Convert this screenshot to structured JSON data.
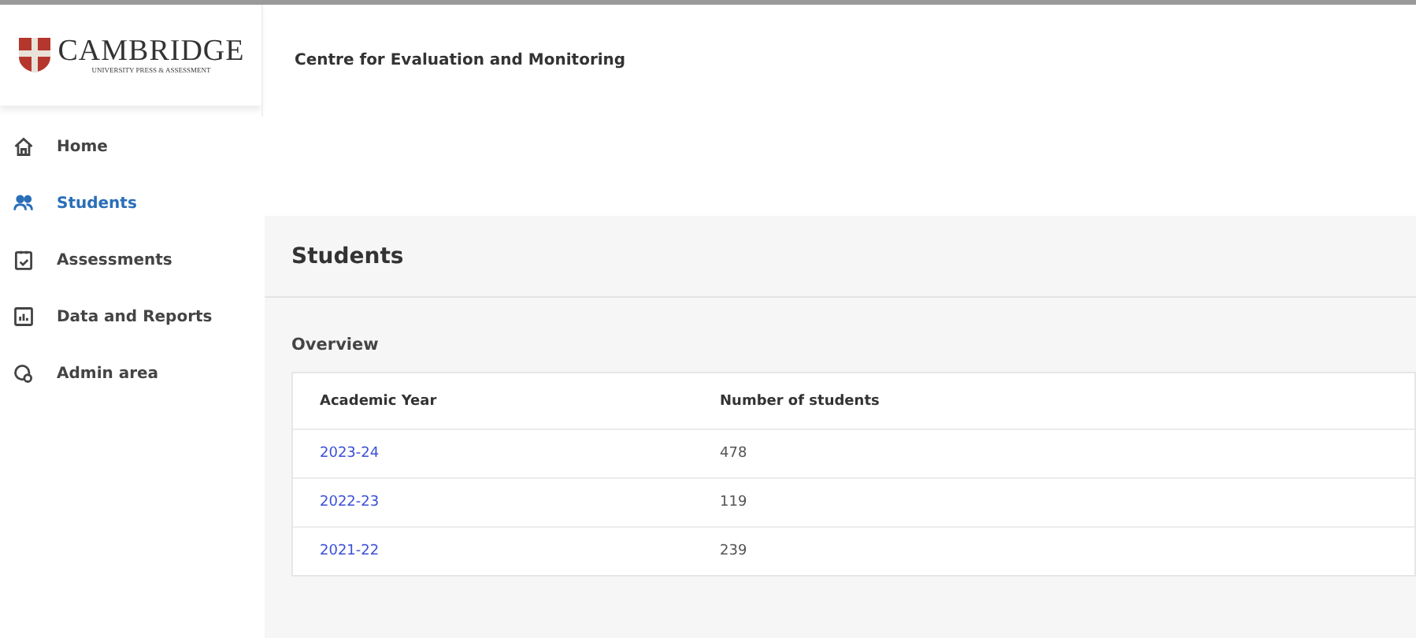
{
  "logo": {
    "name": "CAMBRIDGE",
    "subtitle": "UNIVERSITY PRESS & ASSESSMENT"
  },
  "header": {
    "title": "Centre for Evaluation and Monitoring"
  },
  "sidebar": {
    "items": [
      {
        "label": "Home",
        "kind": "home",
        "selected": false
      },
      {
        "label": "Students",
        "kind": "students",
        "selected": true
      },
      {
        "label": "Assessments",
        "kind": "assessments",
        "selected": false
      },
      {
        "label": "Data and Reports",
        "kind": "reports",
        "selected": false
      },
      {
        "label": "Admin area",
        "kind": "admin",
        "selected": false
      }
    ]
  },
  "page": {
    "title": "Students",
    "section": "Overview"
  },
  "table": {
    "columns": [
      "Academic Year",
      "Number of students"
    ],
    "rows": [
      {
        "year": "2023-24",
        "count": "478"
      },
      {
        "year": "2022-23",
        "count": "119"
      },
      {
        "year": "2021-22",
        "count": "239"
      }
    ]
  }
}
